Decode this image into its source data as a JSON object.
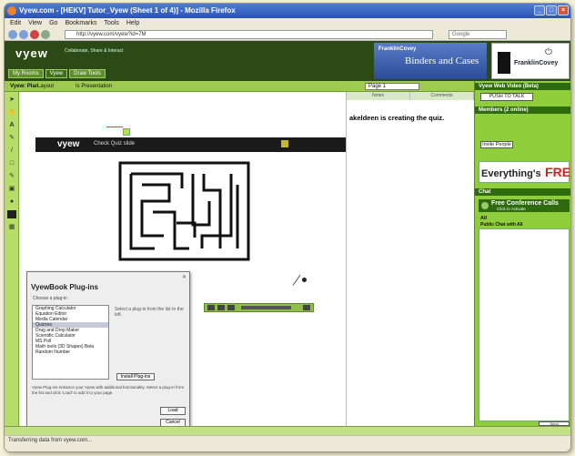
{
  "window": {
    "title": "Vyew.com - [HEKV] Tutor_Vyew (Sheet 1 of 4)] - Mozilla Firefox"
  },
  "menu": [
    "Edit",
    "View",
    "Go",
    "Bookmarks",
    "Tools",
    "Help"
  ],
  "address": {
    "url": "http://vyew.com/vyew?id=7M"
  },
  "search": {
    "placeholder": "Google"
  },
  "brand": {
    "logo": "vyew",
    "tagline": "Collaborate, Share & Interact"
  },
  "header_tabs": [
    "My Rooms",
    "Vyew",
    "Draw Tools"
  ],
  "ads": {
    "banner_brand": "FranklinCovey",
    "banner_tagline": "Binders and Cases",
    "side_brand": "FranklinCovey"
  },
  "toolbar": {
    "label": "Vyew: Plan",
    "option1": "Layout",
    "option2": "Is Presentation",
    "page_select": "Page 1"
  },
  "slide": {
    "logo": "vyew",
    "title": "Check Quiz slide"
  },
  "notes": {
    "tabs": [
      "Notes",
      "Comments"
    ],
    "quiz_message": "akeldeen is creating the quiz."
  },
  "right_panel": {
    "header": "Vyew Web Video (Beta)",
    "push_to_talk": "PUSH TO TALK",
    "people_header": "Members (2 online)",
    "invite_label": "Invite People",
    "ad_everything": "Everything's",
    "ad_free": "FREE",
    "chat_header": "Chat",
    "conf_title": "Free Conference Calls",
    "conf_sub": "Click to Activate",
    "chat_to": "All",
    "chat_scope": "Public Chat with All",
    "send_label": "Send"
  },
  "plugin_dialog": {
    "title": "VyewBook Plug-ins",
    "choose_label": "Choose a plug-in",
    "items": [
      "Graphing Calculator",
      "Equation Editor",
      "Media Calendar",
      "Quizzes",
      "Drag and Drop Maker",
      "Scientific Calculator",
      "MS Poll",
      "Math tools (3D Shapes) Beta",
      "Random Number"
    ],
    "selected_index": 3,
    "description": "Select a plug-in from the list to the left.",
    "install_label": "Install Plug-ins",
    "help_text": "Vyew Plug-ins enhance your Vyew with additional functionality. Select a plug-in from the list and click 'Load' to add it to your page.",
    "ok_label": "Load",
    "cancel_label": "Cancel"
  },
  "status": {
    "text": "Transferring data from vyew.com..."
  }
}
